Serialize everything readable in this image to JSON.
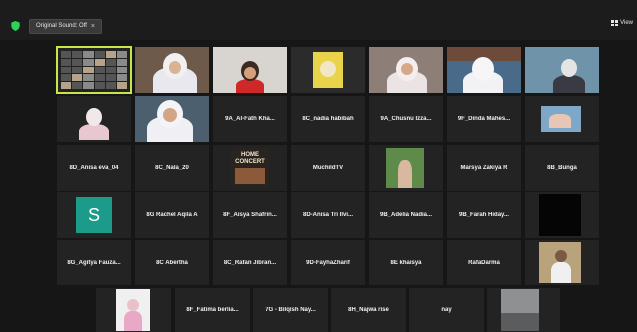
{
  "topbar": {
    "sound_button": "Original Sound: Off",
    "close_glyph": "×",
    "view_label": "View"
  },
  "tiles": {
    "al_fath": "9A_Al-Fath Kha...",
    "nadia": "8C_nadia habibah",
    "chusnu": "9A_Chusnu Izza...",
    "dinda": "9F_Dinda Mahes...",
    "anisa": "8D_Anisa eva_04",
    "nala": "8C_Nala_20",
    "muchild": "MuchildTV",
    "marsya": "Marsya Zakiya R",
    "bunga": "8B_Bunga",
    "rachel": "8G Rachel Aqila A",
    "aisya": "8F_Aisya Shafrin...",
    "anisa_tri": "8D-Anisa Tri Ilvi...",
    "adelia": "9B_Adelia Nadia...",
    "farah": "9B_Farah Hiday...",
    "agitya": "8G_Agitya Fauza...",
    "abertha": "8C Abertha",
    "rafan": "8C_Rafan Jibran...",
    "fayha": "9D-FayhaZharif",
    "khaisya": "8E khaisya",
    "rafadarma": "RafaDarma",
    "fatima": "8F_Fatima berlia...",
    "bilqish": "7G - Bilqish Nay...",
    "najwa": "8H_Najwa rise",
    "nay": "nay",
    "avatar_letter": "S",
    "concert_line1": "HOME",
    "concert_line2": "CONCERT"
  },
  "colors": {
    "background": "#161616",
    "tile": "#232323",
    "active_outline": "#c8e64a",
    "avatar_s": "#1c9a8a"
  }
}
